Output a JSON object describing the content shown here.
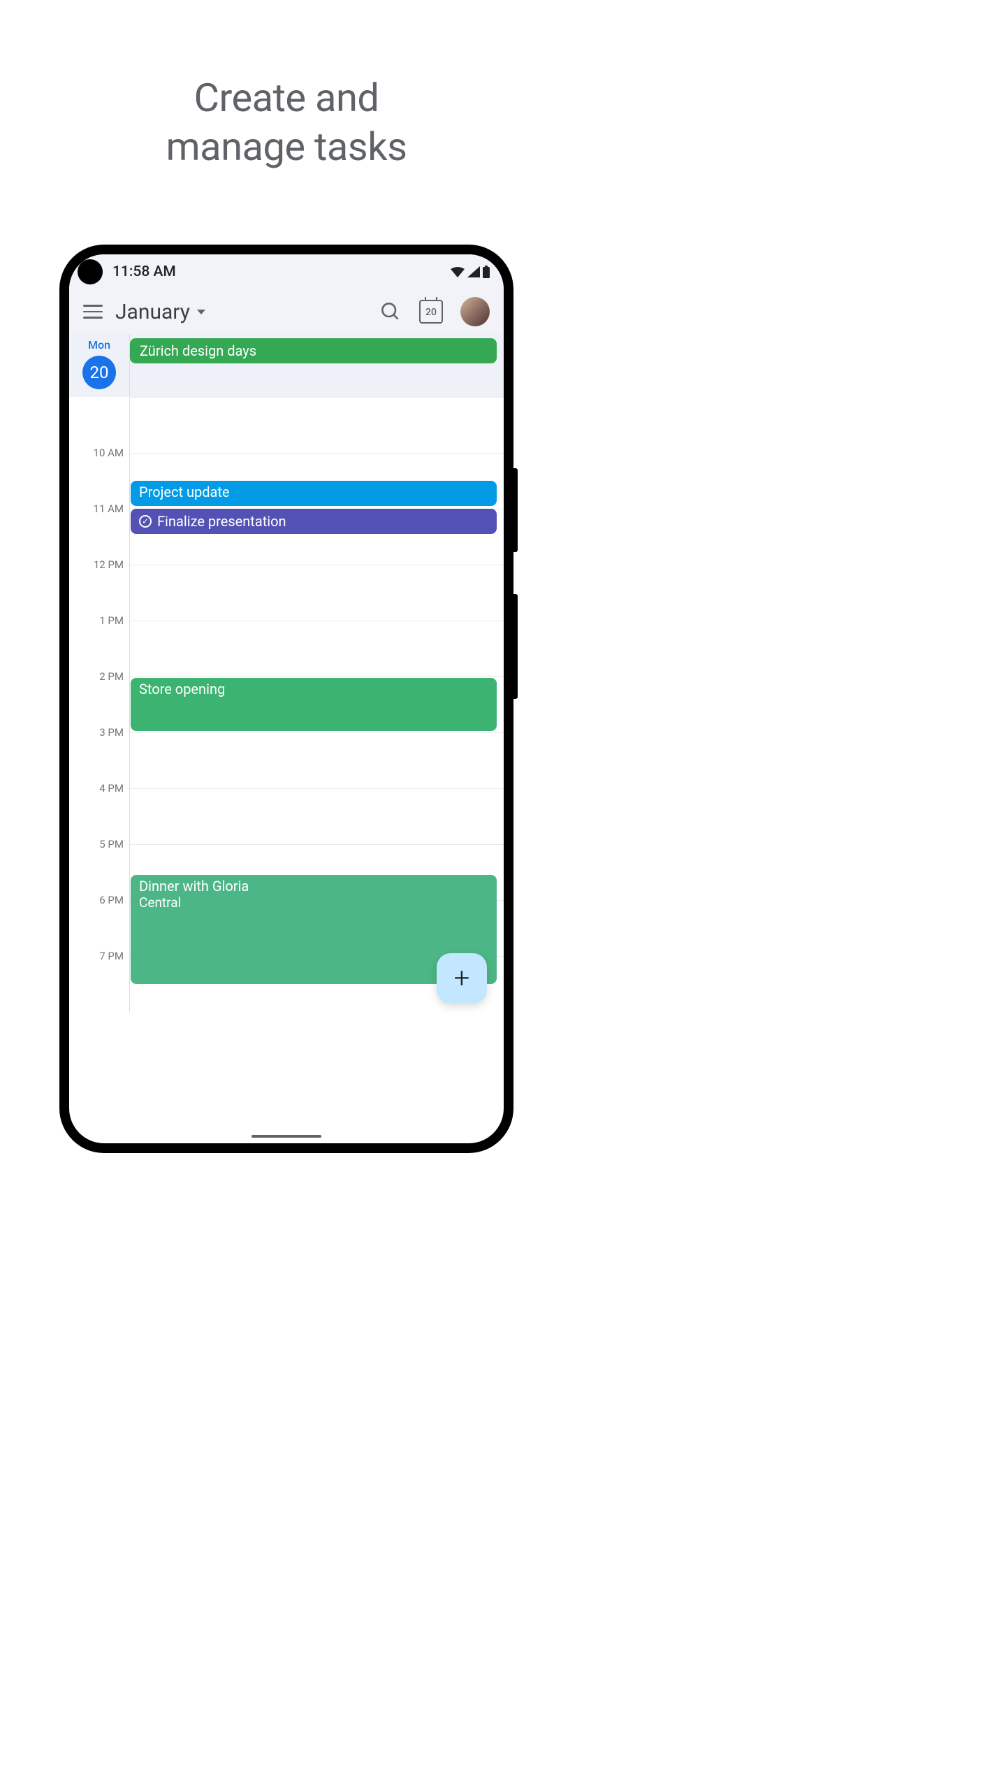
{
  "marketing": {
    "title_line1": "Create and",
    "title_line2": "manage tasks"
  },
  "status": {
    "time": "11:58 AM"
  },
  "header": {
    "month": "January",
    "today_number": "20"
  },
  "day": {
    "name": "Mon",
    "number": "20"
  },
  "allday": {
    "event1": "Zürich design days"
  },
  "hours": {
    "h10": "10 AM",
    "h11": "11 AM",
    "h12": "12 PM",
    "h13": "1 PM",
    "h14": "2 PM",
    "h15": "3 PM",
    "h16": "4 PM",
    "h17": "5 PM",
    "h18": "6 PM",
    "h19": "7 PM"
  },
  "events": {
    "project": "Project update",
    "finalize": "Finalize presentation",
    "store": "Store opening",
    "dinner": "Dinner with Gloria",
    "dinner_loc": "Central"
  }
}
